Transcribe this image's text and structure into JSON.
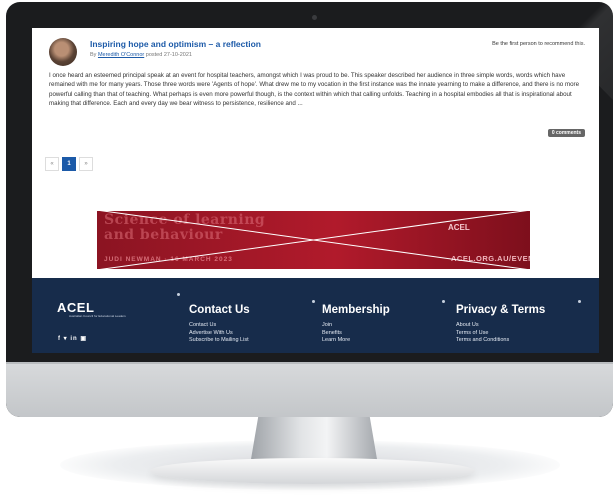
{
  "post": {
    "title": "Inspiring hope and optimism – a reflection",
    "by": "By",
    "author": "Meredith O'Connor",
    "posted": "posted 27-10-2021",
    "recommend": "Be the first person to recommend this.",
    "body": "I once heard an esteemed principal speak at an event for hospital teachers, amongst which I was proud to be. This speaker described her audience in three simple words, words which have remained with me for many years. Those three words were 'Agents of hope'. What drew me to my vocation in the first instance was the innate yearning to make a difference, and there is no more powerful calling than that of teaching. What perhaps is even more powerful though, is the context within which that calling unfolds. Teaching in a hospital embodies all that is inspirational about making that difference. Each and every day we bear witness to persistence, resilience and ...",
    "comments": "0 comments"
  },
  "pager": {
    "prev": "«",
    "current": "1",
    "next": "»"
  },
  "banner": {
    "line1": "Science of learning",
    "line2": "and behaviour",
    "speaker": "JUDI NEWMAN · 16 MARCH 2023",
    "logo": "ACEL",
    "url": "ACEL.ORG.AU/EVENTS"
  },
  "footer": {
    "logo": "ACEL",
    "logo_sub": "Australian Council for Educational Leaders",
    "social": "f ▾ in ▣",
    "contact": {
      "heading": "Contact Us",
      "links": [
        "Contact Us",
        "Advertise With Us",
        "Subscribe to Mailing List"
      ]
    },
    "membership": {
      "heading": "Membership",
      "links": [
        "Join",
        "Benefits",
        "Learn More"
      ]
    },
    "privacy": {
      "heading": "Privacy & Terms",
      "links": [
        "About Us",
        "Terms of Use",
        "Terms and Conditions"
      ]
    }
  },
  "colors": {
    "link_blue": "#1c5aa8",
    "footer_navy": "#172c4b",
    "banner_red": "#b11a2b",
    "bezel": "#1b1c1e"
  }
}
